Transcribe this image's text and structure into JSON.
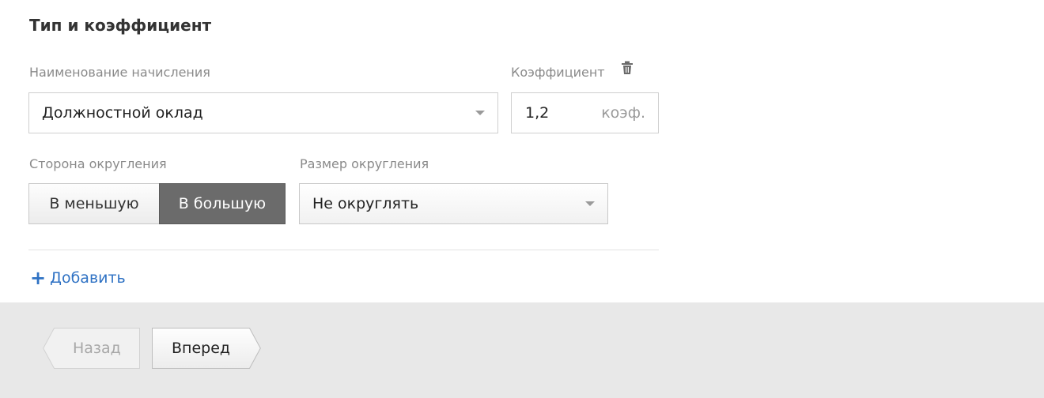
{
  "section": {
    "title": "Тип и коэффициент"
  },
  "accrual": {
    "label": "Наименование начисления",
    "value": "Должностной оклад"
  },
  "coefficient": {
    "label": "Коэффициент",
    "value": "1,2",
    "unit": "коэф."
  },
  "rounding_side": {
    "label": "Сторона округления",
    "options": [
      "В меньшую",
      "В большую"
    ],
    "selected": "В большую"
  },
  "rounding_size": {
    "label": "Размер округления",
    "value": "Не округлять"
  },
  "add_link": {
    "label": "Добавить"
  },
  "footer": {
    "back_label": "Назад",
    "next_label": "Вперед"
  },
  "icons": {
    "trash": "trash-icon",
    "dropdown": "chevron-down-icon",
    "plus": "plus-icon"
  },
  "colors": {
    "accent_link": "#2f72c4",
    "selected_segment": "#6b6b6b",
    "footer_bg": "#e8e8e8"
  }
}
